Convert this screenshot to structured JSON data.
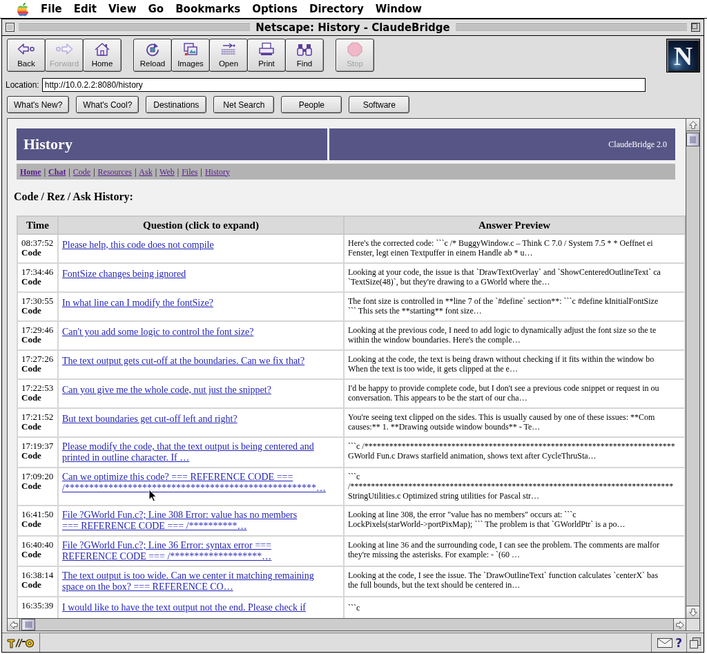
{
  "menu_bar": {
    "items": [
      "File",
      "Edit",
      "View",
      "Go",
      "Bookmarks",
      "Options",
      "Directory",
      "Window"
    ]
  },
  "window": {
    "title": "Netscape: History - ClaudeBridge"
  },
  "toolbar": {
    "groups": [
      [
        {
          "label": "Back",
          "kind": "back",
          "disabled": false
        },
        {
          "label": "Forward",
          "kind": "forward",
          "disabled": true
        },
        {
          "label": "Home",
          "kind": "home",
          "disabled": false
        }
      ],
      [
        {
          "label": "Reload",
          "kind": "reload",
          "disabled": false
        },
        {
          "label": "Images",
          "kind": "images",
          "disabled": false
        },
        {
          "label": "Open",
          "kind": "open",
          "disabled": false
        },
        {
          "label": "Print",
          "kind": "print",
          "disabled": false
        },
        {
          "label": "Find",
          "kind": "find",
          "disabled": false
        }
      ],
      [
        {
          "label": "Stop",
          "kind": "stop",
          "disabled": true
        }
      ]
    ],
    "logo": "N"
  },
  "location": {
    "label": "Location:",
    "value": "http://10.0.2.2:8080/history"
  },
  "directory_buttons": [
    "What's New?",
    "What's Cool?",
    "Destinations",
    "Net Search",
    "People",
    "Software"
  ],
  "page": {
    "banner": {
      "title": "History",
      "version": "ClaudeBridge 2.0"
    },
    "nav": {
      "links": [
        {
          "label": "Home",
          "bold": true,
          "separator": "|"
        },
        {
          "label": "Chat",
          "bold": true,
          "separator": "|"
        },
        {
          "label": "Code",
          "bold": false,
          "separator": "|"
        },
        {
          "label": "Resources",
          "bold": false,
          "separator": "|"
        },
        {
          "label": "Ask",
          "bold": false,
          "separator": "|"
        },
        {
          "label": "Web",
          "bold": false,
          "separator": "|"
        },
        {
          "label": "Files",
          "bold": false,
          "separator": "|"
        },
        {
          "label": "History",
          "bold": false
        }
      ]
    },
    "heading": "Code / Rez / Ask History:",
    "table": {
      "columns": [
        "Time",
        "Question (click to expand)",
        "Answer Preview"
      ],
      "rows": [
        {
          "time": "08:37:52",
          "category": "Code",
          "question": "Please help, this code does not compile",
          "answer": "Here's the corrected code: ```c /* BuggyWindow.c – Think C 7.0 / System 7.5 * * Oeffnet ei\nFenster, legt einen Textpuffer in einem Handle ab * u…"
        },
        {
          "time": "17:34:46",
          "category": "Code",
          "question": "FontSize changes being ignored",
          "answer": "Looking at your code, the issue is that `DrawTextOverlay` and `ShowCenteredOutlineText` ca\n`TextSize(48)`, but they're drawing to a GWorld where the…"
        },
        {
          "time": "17:30:55",
          "category": "Code",
          "question": "In what line can I modify the fontSize?",
          "answer": "The font size is controlled in **line 7 of the `#define` section**: ```c #define kInitialFontSize\n``` This sets the **starting** font size…"
        },
        {
          "time": "17:29:46",
          "category": "Code",
          "question": "Can't you add some logic to control the font size?",
          "answer": "Looking at the previous code, I need to add logic to dynamically adjust the font size so the te\nwithin the window boundaries. Here's the comple…"
        },
        {
          "time": "17:27:26",
          "category": "Code",
          "question": "The text output gets cut-off at the boundaries. Can we fix that?",
          "answer": "Looking at the code, the text is being drawn without checking if it fits within the window bo\nWhen the text is too wide, it gets clipped at the e…"
        },
        {
          "time": "17:22:53",
          "category": "Code",
          "question": "Can you give me the whole code, nut just the snippet?",
          "answer": "I'd be happy to provide complete code, but I don't see a previous code snippet or request in ou\nconversation. This appears to be the start of our cha…"
        },
        {
          "time": "17:21:52",
          "category": "Code",
          "question": "But text boundaries get cut-off left and right?",
          "answer": "You're seeing text clipped on the sides. This is usually caused by one of these issues: **Com\ncauses:** 1. **Drawing outside window bounds** - Te…"
        },
        {
          "time": "17:19:37",
          "category": "Code",
          "question": "Please modify the code, that the text output is being centered and\nprinted in outline character. If …",
          "answer": "```c /***************************************************************************\nGWorld Fun.c Draws starfield animation, shows text after CycleThruSta…"
        },
        {
          "time": "17:09:20",
          "category": "Code",
          "question": "Can we optimize this code? === REFERENCE CODE ===\n/****************************************************…",
          "answer": "```c\n/******************************************************************************\nStringUtilities.c Optimized string utilities for Pascal str…"
        },
        {
          "time": "16:41:50",
          "category": "Code",
          "question": "File ?GWorld Fun.c?; Line 308 Error: value has no members\n=== REFERENCE CODE === /**********…",
          "answer": "Looking at line 308, the error \"value has no members\" occurs at: ```c\nLockPixels(starWorld->portPixMap); ``` The problem is that `GWorldPtr` is a po…"
        },
        {
          "time": "16:40:40",
          "category": "Code",
          "question": "File ?GWorld Fun.c?; Line 36 Error: syntax error ===\nREFERENCE CODE === /*******************…",
          "answer": "Looking at line 36 and the surrounding code, I can see the problem. The comments are malfor\nthey're missing the asterisks. For example: - `(60 …"
        },
        {
          "time": "16:38:14",
          "category": "Code",
          "question": "The text output is too wide. Can we center it matching remaining\nspace on the box? === REFERENCE CO…",
          "answer": "Looking at the code, I see the issue. The `DrawOutlineText` function calculates `centerX` bas\nthe full bounds, but the text should be centered in…"
        },
        {
          "time": "16:35:39",
          "question": "I would like to have the text output not the end. Please check if",
          "answer": "```c"
        }
      ]
    }
  },
  "status_bar": {
    "help": "?"
  }
}
